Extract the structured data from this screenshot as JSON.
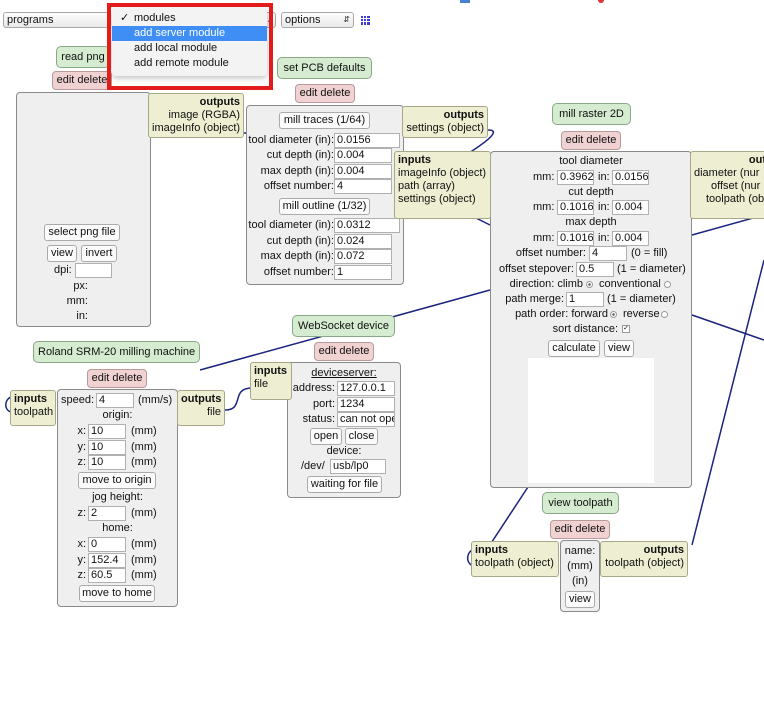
{
  "toolbar": {
    "programs": "programs",
    "edit_partial": "it",
    "options": "options",
    "colors": {
      "grid_icon": "#3b3bd9"
    }
  },
  "menu": {
    "items": [
      "modules",
      "add server module",
      "add local module",
      "add remote module"
    ],
    "checked": "modules",
    "highlighted": "add server module",
    "frame_color": "#e21b1b"
  },
  "edit_delete": "edit delete",
  "read_png": {
    "title": "read png",
    "outputs_header": "outputs",
    "outputs": [
      "image (RGBA)",
      "imageInfo (object)"
    ],
    "select_button": "select png file",
    "view_button": "view",
    "invert_button": "invert",
    "dpi_label": "dpi:",
    "px_label": "px:",
    "mm_label": "mm:",
    "in_label": "in:"
  },
  "pcb_defaults": {
    "title": "set PCB defaults",
    "outputs_header": "outputs",
    "outputs": [
      "settings (object)"
    ],
    "traces_button": "mill traces (1/64)",
    "outline_button": "mill outline (1/32)",
    "traces": [
      {
        "label": "tool diameter (in):",
        "value": "0.0156"
      },
      {
        "label": "cut depth (in):",
        "value": "0.004"
      },
      {
        "label": "max depth (in):",
        "value": "0.004"
      },
      {
        "label": "offset number:",
        "value": "4"
      }
    ],
    "outline": [
      {
        "label": "tool diameter (in):",
        "value": "0.0312"
      },
      {
        "label": "cut depth (in):",
        "value": "0.024"
      },
      {
        "label": "max depth (in):",
        "value": "0.072"
      },
      {
        "label": "offset number:",
        "value": "1"
      }
    ]
  },
  "mill_raster": {
    "title": "mill raster 2D",
    "inputs_header": "inputs",
    "inputs": [
      "imageInfo (object)",
      "path (array)",
      "settings (object)"
    ],
    "outputs_header": "out",
    "outputs": [
      "diameter (nur",
      "offset (nur",
      "toolpath (obj"
    ],
    "tool_diameter_label": "tool diameter",
    "tool_diameter_mm": "0.3962",
    "tool_diameter_in": "0.0156",
    "cut_depth_label": "cut depth",
    "cut_depth_mm": "0.1016",
    "cut_depth_in": "0.004",
    "max_depth_label": "max depth",
    "max_depth_mm": "0.1016",
    "max_depth_in": "0.004",
    "mm_label": "mm:",
    "in_label": "in:",
    "offset_number_label": "offset number:",
    "offset_number": "4",
    "offset_number_note": "(0 = fill)",
    "stepover_label": "offset stepover:",
    "stepover": "0.5",
    "stepover_note": "(1 = diameter)",
    "direction_label": "direction: climb",
    "direction_conventional": "conventional",
    "merge_label": "path merge:",
    "merge": "1",
    "merge_note": "(1 = diameter)",
    "order_label": "path order: forward",
    "order_reverse": "reverse",
    "sort_label": "sort distance:",
    "calculate_button": "calculate",
    "view_button": "view"
  },
  "websocket": {
    "title": "WebSocket device",
    "inputs_header": "inputs",
    "inputs": [
      "file"
    ],
    "deviceserver_label": "deviceserver:",
    "address_label": "address:",
    "address": "127.0.0.1",
    "port_label": "port:",
    "port": "1234",
    "status_label": "status:",
    "status": "can not ope",
    "open_button": "open",
    "close_button": "close",
    "device_label": "device:",
    "device_prefix": "/dev/",
    "device": "usb/lp0",
    "waiting_button": "waiting for file"
  },
  "roland": {
    "title": "Roland SRM-20 milling machine",
    "inputs_header": "inputs",
    "inputs": [
      "toolpath"
    ],
    "outputs_header": "outputs",
    "outputs": [
      "file"
    ],
    "speed_label": "speed:",
    "speed": "4",
    "speed_unit": "(mm/s)",
    "origin_label": "origin:",
    "origin": [
      {
        "axis": "x:",
        "value": "10",
        "unit": "(mm)"
      },
      {
        "axis": "y:",
        "value": "10",
        "unit": "(mm)"
      },
      {
        "axis": "z:",
        "value": "10",
        "unit": "(mm)"
      }
    ],
    "move_origin_button": "move to origin",
    "jog_label": "jog height:",
    "jog": {
      "axis": "z:",
      "value": "2",
      "unit": "(mm)"
    },
    "home_label": "home:",
    "home": [
      {
        "axis": "x:",
        "value": "0",
        "unit": "(mm)"
      },
      {
        "axis": "y:",
        "value": "152.4",
        "unit": "(mm)"
      },
      {
        "axis": "z:",
        "value": "60.5",
        "unit": "(mm)"
      }
    ],
    "move_home_button": "move to home"
  },
  "view_toolpath": {
    "title": "view toolpath",
    "inputs_header": "inputs",
    "inputs": [
      "toolpath (object)"
    ],
    "outputs_header": "outputs",
    "outputs": [
      "toolpath (object)"
    ],
    "name_label": "name:",
    "mm_label": "(mm)",
    "in_label": "(in)",
    "view_button": "view"
  },
  "colors": {
    "wire": "#1a237e",
    "title_bg": "#d5ecd0",
    "edit_bg": "#f1d2d2",
    "io_bg": "#eeeed2",
    "menu_highlight": "#3f8ef5"
  }
}
